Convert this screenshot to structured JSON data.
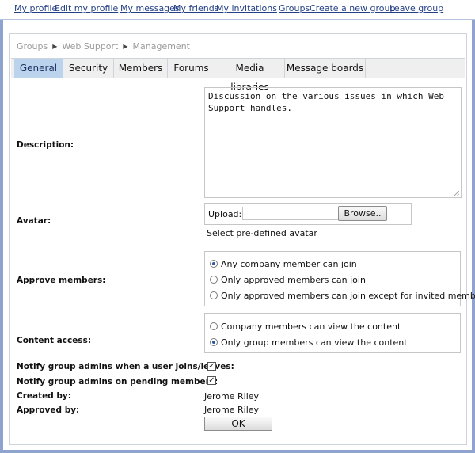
{
  "topnav": {
    "my_profile": "My profile",
    "edit_my_profile": "Edit my profile",
    "my_messages": "My messages",
    "my_friends": "My friends",
    "my_invitations": "My invitations",
    "groups": "Groups",
    "create_group": "Create a new group",
    "leave_group": "Leave group"
  },
  "breadcrumb": [
    "Groups",
    "Web Support",
    "Management"
  ],
  "tabs": [
    "General",
    "Security",
    "Members",
    "Forums",
    "Media libraries",
    "Message boards"
  ],
  "active_tab": "General",
  "form": {
    "description_label": "Description:",
    "description_value": "Discussion on the various issues in which Web Support handles.",
    "avatar_label": "Avatar:",
    "upload_label": "Upload:",
    "browse_label": "Browse..",
    "predefined_avatar": "Select pre-defined avatar",
    "approve_label": "Approve members:",
    "approve_options": [
      "Any company member can join",
      "Only approved members can join",
      "Only approved members can join except for invited members"
    ],
    "approve_selected": 0,
    "content_label": "Content access:",
    "content_options": [
      "Company members can view the content",
      "Only group members can view the content"
    ],
    "content_selected": 1,
    "notify_join_label": "Notify group admins when a user joins/leaves:",
    "notify_join_checked": true,
    "notify_pending_label": "Notify group admins on pending members:",
    "notify_pending_checked": true,
    "created_by_label": "Created by:",
    "created_by_value": "Jerome Riley",
    "approved_by_label": "Approved by:",
    "approved_by_value": "Jerome Riley",
    "ok_label": "OK"
  },
  "colors": {
    "link": "#233f86",
    "frame_border": "#8fa3cf",
    "active_tab": "#bcd3ee"
  }
}
